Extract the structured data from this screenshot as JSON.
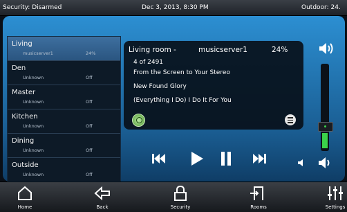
{
  "status_bar": {
    "security": "Security: Disarmed",
    "datetime": "Dec 3, 2013, 8:30 PM",
    "outdoor": "Outdoor: 24."
  },
  "rooms": [
    {
      "name": "Living",
      "source": "musicserver1",
      "volume": "24%",
      "active": true
    },
    {
      "name": "Den",
      "source": "Unknown",
      "volume": "Off",
      "active": false
    },
    {
      "name": "Master",
      "source": "Unknown",
      "volume": "Off",
      "active": false
    },
    {
      "name": "Kitchen",
      "source": "Unknown",
      "volume": "Off",
      "active": false
    },
    {
      "name": "Dining",
      "source": "Unknown",
      "volume": "Off",
      "active": false
    },
    {
      "name": "Outside",
      "source": "Unknown",
      "volume": "Off",
      "active": false
    }
  ],
  "player": {
    "room": "Living room -",
    "source": "musicserver1",
    "volume": "24%",
    "track_position": "4 of 2491",
    "album": "From the Screen to Your Stereo",
    "artist": "New Found Glory",
    "title": "(Everything I Do) I Do It For You"
  },
  "volume_slider": {
    "level_percent": 24
  },
  "nav": [
    {
      "label": "Home",
      "icon": "home-icon"
    },
    {
      "label": "Back",
      "icon": "back-arrow-icon"
    },
    {
      "label": "Security",
      "icon": "lock-icon"
    },
    {
      "label": "Rooms",
      "icon": "door-icon"
    },
    {
      "label": "Settings",
      "icon": "sliders-icon"
    }
  ],
  "colors": {
    "accent": "#2c8fd2",
    "volume_fill": "#3bd14a",
    "power": "#4f9a33"
  }
}
